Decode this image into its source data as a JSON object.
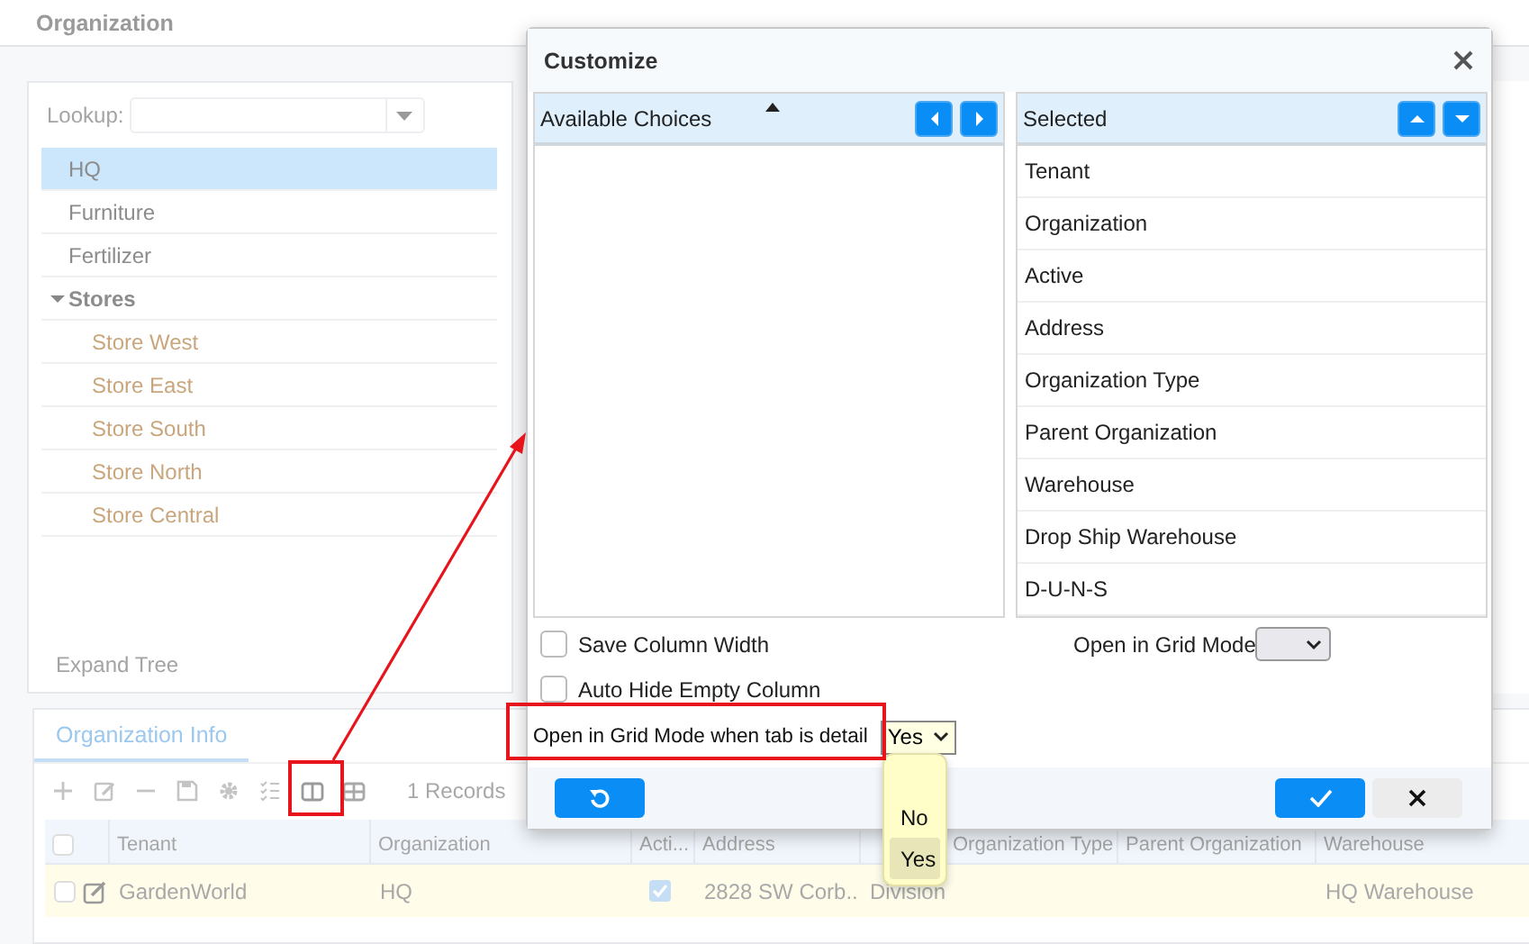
{
  "page": {
    "title": "Organization"
  },
  "tree_panel": {
    "lookup_label": "Lookup:",
    "items": [
      {
        "label": "HQ",
        "selected": true
      },
      {
        "label": "Furniture",
        "selected": false
      },
      {
        "label": "Fertilizer",
        "selected": false
      },
      {
        "label": "Stores",
        "selected": false,
        "expanded": true,
        "children": [
          {
            "label": "Store West",
            "selected": false
          },
          {
            "label": "Store East",
            "selected": false
          },
          {
            "label": "Store South",
            "selected": false
          },
          {
            "label": "Store North",
            "selected": false
          },
          {
            "label": "Store Central",
            "selected": false
          }
        ]
      }
    ],
    "expand_tree": "Expand Tree"
  },
  "detail": {
    "tab": {
      "label": "Organization Info",
      "selected": true
    },
    "records": "1 Records",
    "all_selected": false,
    "columns": [
      "Tenant",
      "Organization",
      "Acti...",
      "Address",
      "Organization Type",
      "Parent Organization",
      "Warehouse"
    ],
    "rows": [
      {
        "selected": false,
        "cells": [
          "GardenWorld",
          "HQ",
          "",
          "2828 SW Corb...",
          "Division",
          "",
          "HQ Warehouse"
        ],
        "active": true
      }
    ]
  },
  "dialog": {
    "title": "Customize",
    "available": {
      "title": "Available Choices"
    },
    "selected": {
      "title": "Selected",
      "items": [
        "Tenant",
        "Organization",
        "Active",
        "Address",
        "Organization Type",
        "Parent Organization",
        "Warehouse",
        "Drop Ship Warehouse",
        "D-U-N-S"
      ]
    },
    "options": [
      {
        "label": "Save Column Width",
        "checked": false
      },
      {
        "label": "Auto Hide Empty Column",
        "checked": false
      }
    ],
    "grid_mode": {
      "label": "Open in Grid Mode"
    },
    "grid_mode_detail": {
      "label": "Open in Grid Mode when tab is detail",
      "value": "Yes",
      "open": true,
      "options": [
        {
          "label": "No",
          "selected": false
        },
        {
          "label": "Yes",
          "selected": true
        }
      ]
    }
  }
}
